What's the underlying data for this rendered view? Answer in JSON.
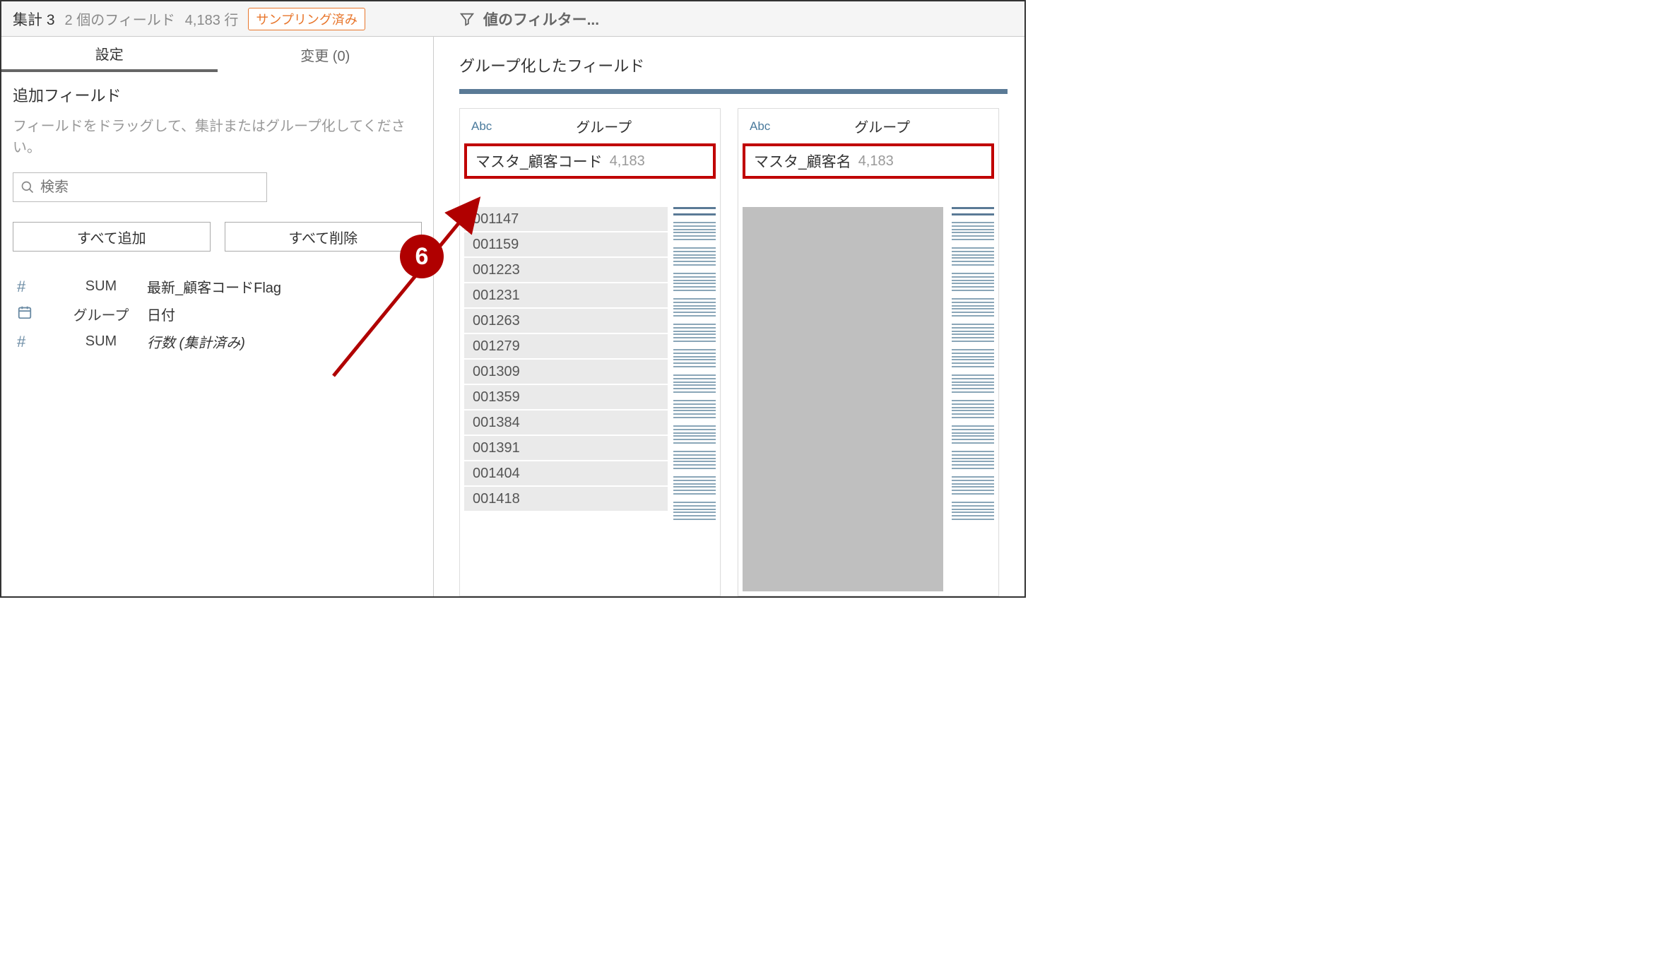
{
  "header": {
    "step_name": "集計 3",
    "field_count_label": "2 個のフィールド",
    "row_count_label": "4,183 行",
    "sampled_badge": "サンプリング済み",
    "filter_label": "値のフィルター..."
  },
  "tabs": {
    "settings": "設定",
    "changes": "変更 (0)"
  },
  "left": {
    "additional_fields_title": "追加フィールド",
    "hint": "フィールドをドラッグして、集計またはグループ化してください。",
    "search_placeholder": "検索",
    "add_all": "すべて追加",
    "remove_all": "すべて削除",
    "rows": [
      {
        "type": "#",
        "agg": "SUM",
        "name": "最新_顧客コードFlag",
        "italic": false
      },
      {
        "type": "date",
        "agg": "グループ",
        "name": "日付",
        "italic": false
      },
      {
        "type": "#",
        "agg": "SUM",
        "name": "行数 (集計済み)",
        "italic": true
      }
    ]
  },
  "right": {
    "grouped_title": "グループ化したフィールド",
    "abc": "Abc",
    "group": "グループ",
    "cards": [
      {
        "field_name": "マスタ_顧客コード",
        "count": "4,183",
        "values": [
          "001147",
          "001159",
          "001223",
          "001231",
          "001263",
          "001279",
          "001309",
          "001359",
          "001384",
          "001391",
          "001404",
          "001418"
        ]
      },
      {
        "field_name": "マスタ_顧客名",
        "count": "4,183",
        "values": []
      }
    ]
  },
  "annotation": {
    "badge": "6"
  }
}
